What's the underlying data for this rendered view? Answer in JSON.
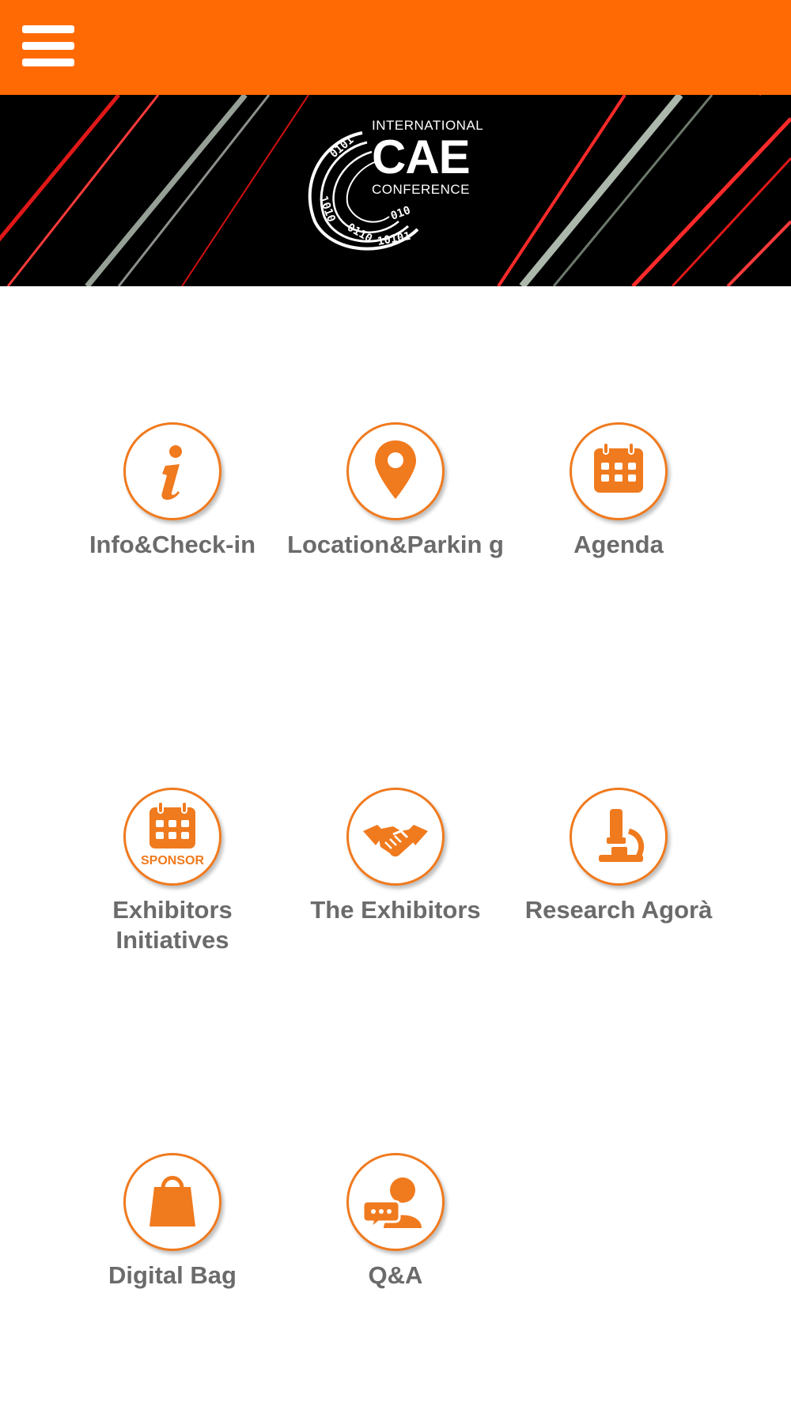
{
  "appbar": {
    "menu_icon": "hamburger-menu-icon",
    "color": "#ff6a05"
  },
  "banner": {
    "logo": {
      "line1": "INTERNATIONAL",
      "line2": "CAE",
      "line3": "CONFERENCE"
    }
  },
  "accent_color": "#f07a1e",
  "label_color": "#6b6b6b",
  "menu": {
    "items": [
      {
        "label": "Info&Check-in",
        "icon": "info-icon"
      },
      {
        "label": "Location&Parkin g",
        "icon": "location-pin-icon"
      },
      {
        "label": "Agenda",
        "icon": "calendar-icon"
      },
      {
        "label": "Exhibitors Initiatives",
        "icon": "sponsor-calendar-icon",
        "icon_text": "SPONSOR"
      },
      {
        "label": "The Exhibitors",
        "icon": "handshake-icon"
      },
      {
        "label": "Research Agorà",
        "icon": "microscope-icon"
      },
      {
        "label": "Digital Bag",
        "icon": "shopping-bag-icon"
      },
      {
        "label": "Q&A",
        "icon": "chat-person-icon"
      }
    ]
  }
}
